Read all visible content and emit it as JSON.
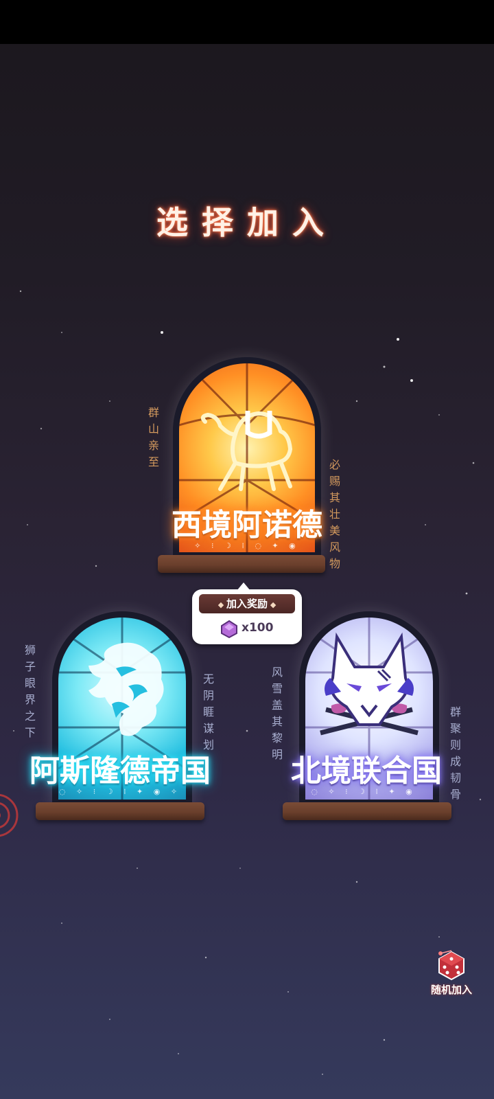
{
  "title": "选择加入",
  "factions": [
    {
      "name": "西境阿诺德",
      "slogan_left": "群山亲至",
      "slogan_right": "必赐其壮美风物",
      "runes": "✧ ⁝ ☽ ⁞ ◌ ✦ ◉",
      "emblem": "camel-icon",
      "theme_color": "#ff8a1e"
    },
    {
      "name": "阿斯隆德帝国",
      "slogan_left": "狮子眼界之下",
      "slogan_right": "无阴睚谋划",
      "runes": "◌ ✧ ⁝ ☽ ⁞ ✦ ◉ ✧",
      "emblem": "lion-icon",
      "theme_color": "#2fd6e8"
    },
    {
      "name": "北境联合国",
      "slogan_left": "风雪盖其黎明",
      "slogan_right": "群聚则成韧骨",
      "runes": "◌ ✧ ⁝ ☽ ⁞ ✦ ◉",
      "emblem": "wolf-icon",
      "theme_color": "#6a5cff"
    }
  ],
  "reward": {
    "label": "加入奖励",
    "count": "x100",
    "icon": "gem-icon"
  },
  "random_button": {
    "label": "随机加入",
    "icon": "dice-icon"
  }
}
